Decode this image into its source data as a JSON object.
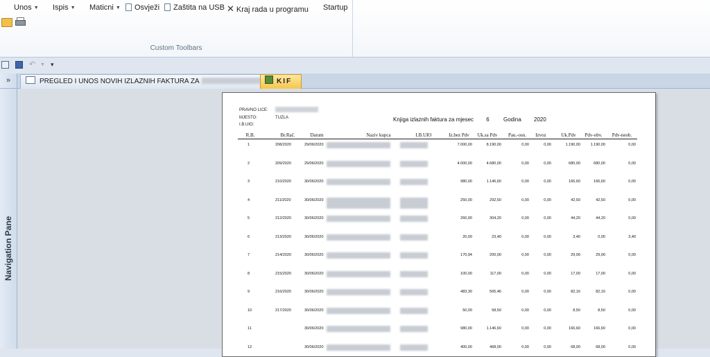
{
  "ribbon": {
    "menu": [
      {
        "label": "Unos",
        "has_dropdown": true
      },
      {
        "label": "Ispis",
        "has_dropdown": true
      },
      {
        "label": "Maticni",
        "has_dropdown": true
      },
      {
        "label": "Osvježi",
        "icon": "document-icon"
      },
      {
        "label": "Zaštita na USB",
        "icon": "document-icon"
      },
      {
        "label": "Kraj rada u programu",
        "icon": "close-icon"
      },
      {
        "label": "Startup"
      }
    ],
    "group_caption": "Custom Toolbars"
  },
  "navigation_pane": {
    "toggle": "»",
    "label": "Navigation Pane"
  },
  "tabs": [
    {
      "label": "PREGLED I UNOS NOVIH IZLAZNIH FAKTURA ZA",
      "active": false
    },
    {
      "label": "KIF",
      "active": true
    }
  ],
  "report": {
    "labels": {
      "pravno_lice": "PRAVNO LICE:",
      "mjesto": "MJESTO:",
      "mjesto_value": "TUZLA",
      "ibuio": "I.B.UIO:"
    },
    "title": "Knjiga izlaznih faktura za mjesec",
    "month": "6",
    "year_label": "Godina",
    "year": "2020",
    "columns": [
      "R.B.",
      "Br.Rač.",
      "Datum",
      "Naziv kupca",
      "I.B.UIO",
      "Iz.bez Pdv",
      "Uk.sa Pdv",
      "Pau.-osn.",
      "Izvoz",
      "Uk.Pdv",
      "Pdv-obv.",
      "Pdv-neob."
    ],
    "rows": [
      {
        "rb": "1",
        "br": "208/2020",
        "datum": "29/06/2020",
        "bez": "7.000,00",
        "sa": "8.190,00",
        "pau": "0,00",
        "izvoz": "0,00",
        "ukpdv": "1.190,00",
        "obv": "1.190,00",
        "neob": "0,00"
      },
      {
        "rb": "2",
        "br": "209/2020",
        "datum": "29/06/2020",
        "bez": "4.000,00",
        "sa": "4.680,00",
        "pau": "0,00",
        "izvoz": "0,00",
        "ukpdv": "680,00",
        "obv": "680,00",
        "neob": "0,00"
      },
      {
        "rb": "3",
        "br": "210/2020",
        "datum": "30/06/2020",
        "bez": "980,00",
        "sa": "1.146,60",
        "pau": "0,00",
        "izvoz": "0,00",
        "ukpdv": "166,60",
        "obv": "166,60",
        "neob": "0,00"
      },
      {
        "rb": "4",
        "br": "211/2020",
        "datum": "30/06/2020",
        "bez": "250,00",
        "sa": "292,50",
        "pau": "0,00",
        "izvoz": "0,00",
        "ukpdv": "42,50",
        "obv": "42,50",
        "neob": "0,00"
      },
      {
        "rb": "5",
        "br": "212/2020",
        "datum": "30/06/2020",
        "bez": "260,00",
        "sa": "304,20",
        "pau": "0,00",
        "izvoz": "0,00",
        "ukpdv": "44,20",
        "obv": "44,20",
        "neob": "0,00"
      },
      {
        "rb": "6",
        "br": "213/2020",
        "datum": "30/06/2020",
        "bez": "20,00",
        "sa": "23,40",
        "pau": "0,00",
        "izvoz": "0,00",
        "ukpdv": "3,40",
        "obv": "0,00",
        "neob": "3,40"
      },
      {
        "rb": "7",
        "br": "214/2020",
        "datum": "30/06/2020",
        "bez": "170,94",
        "sa": "200,00",
        "pau": "0,00",
        "izvoz": "0,00",
        "ukpdv": "29,06",
        "obv": "29,06",
        "neob": "0,00"
      },
      {
        "rb": "8",
        "br": "215/2020",
        "datum": "30/06/2020",
        "bez": "100,00",
        "sa": "117,00",
        "pau": "0,00",
        "izvoz": "0,00",
        "ukpdv": "17,00",
        "obv": "17,00",
        "neob": "0,00"
      },
      {
        "rb": "9",
        "br": "216/2020",
        "datum": "30/06/2020",
        "bez": "483,30",
        "sa": "565,46",
        "pau": "0,00",
        "izvoz": "0,00",
        "ukpdv": "82,16",
        "obv": "82,16",
        "neob": "0,00"
      },
      {
        "rb": "10",
        "br": "217/2020",
        "datum": "30/06/2020",
        "bez": "50,00",
        "sa": "58,50",
        "pau": "0,00",
        "izvoz": "0,00",
        "ukpdv": "8,50",
        "obv": "8,50",
        "neob": "0,00"
      },
      {
        "rb": "11",
        "br": "",
        "datum": "30/06/2020",
        "bez": "980,00",
        "sa": "1.146,60",
        "pau": "0,00",
        "izvoz": "0,00",
        "ukpdv": "166,60",
        "obv": "166,60",
        "neob": "0,00"
      },
      {
        "rb": "12",
        "br": "",
        "datum": "30/06/2020",
        "bez": "400,00",
        "sa": "468,00",
        "pau": "0,00",
        "izvoz": "0,00",
        "ukpdv": "68,00",
        "obv": "68,00",
        "neob": "0,00"
      }
    ]
  }
}
